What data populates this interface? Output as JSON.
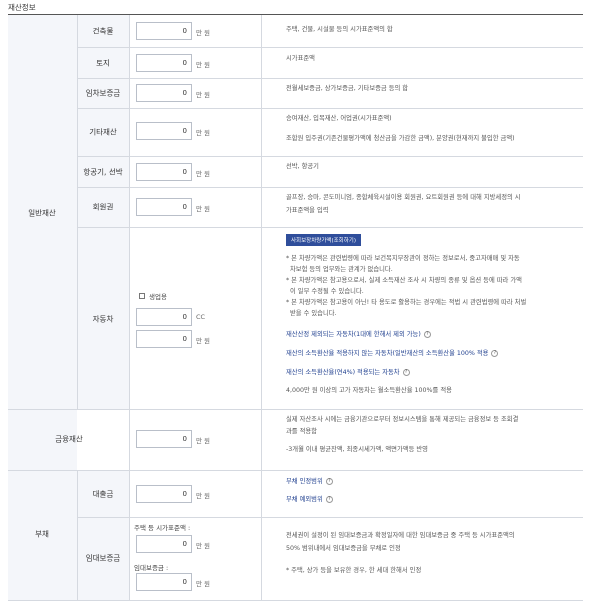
{
  "section_title": "재산정보",
  "categories": {
    "general": "일반재산",
    "financial": "금융재산",
    "debt": "부채"
  },
  "unit_won": "만 원",
  "unit_cc": "CC",
  "rows": {
    "building": {
      "label": "건축물",
      "value": "0",
      "desc": "주택, 건물, 시설물 등의 시가표준액의 합"
    },
    "land": {
      "label": "토지",
      "value": "0",
      "desc": "시가표준액"
    },
    "lease": {
      "label": "임차보증금",
      "value": "0",
      "desc": "전월세보증금, 상가보증금, 기타보증금 등의 합"
    },
    "other": {
      "label": "기타재산",
      "value": "0",
      "desc1": "승여재산, 입목재산, 어업권(시가표준액)",
      "desc2": "조합원 입주권(기존건물평가액에 청산금을 가감한 금액), 분양권(현재까지 불입한 금액)"
    },
    "aircraft": {
      "label": "항공기, 선박",
      "value": "0",
      "desc": "선박, 항공기"
    },
    "membership": {
      "label": "회원권",
      "value": "0",
      "desc1": "골프장, 승마, 콘도미니엄, 종합체육시설이용 회원권, 요트회원권 등에 대해 지방세정의 시",
      "desc2": "가표준액을 입력"
    },
    "car": {
      "label": "자동차",
      "business_use": "생업용",
      "cc_value": "0",
      "value": "0",
      "button": "사회보장차량가액(조회하기)",
      "notes": [
        "* 본 차량가액은 관련법령에 따라 보건복지부장관이 정하는 정보로서, 중고자매매 및 자동",
        "차보험 등의 업무와는 관계가 없습니다.",
        "* 본 차량가액은 참고용으로서, 실제 소득재산 조사 시 차량의 종류 및 옵션 등에 따라 가액",
        "이 일부 수정될 수 있습니다.",
        "* 본 차량가액은 참고용이 아닌! 타 용도로 활용하는 경우에는 적법 시 관련법령에 따라 처벌",
        "받을 수 있습니다."
      ],
      "links": [
        "재산산정 제외되는 자동차(1대에 한해서 제외 가능)",
        "재산의 소득환산율 적용하지 않는 자동차(일반재산의 소득환산율 100% 적용",
        "재산의 소득환산율(연4%) 적용되는 자동차",
        "4,000만 원 이상의 고가 자동차는 월소득환산율 100%를 적용"
      ]
    },
    "financial": {
      "value": "0",
      "desc1": "실제 자산조사 시에는 금융기관으로부터 정보시스템을 통해 제공되는 금융정보 등 조회결",
      "desc2": "과를 적용함",
      "desc3": "-3개월 이내 평균잔액, 최종시세가액, 액면가액등 반영"
    },
    "loan": {
      "label": "대출금",
      "value": "0",
      "link1": "부채 인정범위",
      "link2": "부채 예외범위"
    },
    "lease_deposit": {
      "label": "임대보증금",
      "sub_label1": "주택 등 시가표준액 :",
      "value1": "0",
      "sub_label2": "임대보증금 :",
      "value2": "0",
      "desc1": "전세권이 설정이 된 임대보증금과 확정일자에 대한 임대보증금 중 주택 등 시가표준액의",
      "desc2": "50% 범위내에서 임대보증금을 부채로 인정",
      "desc3": "* 주택, 상가 등을 보유한 경우, 한 세대 한해서 인정"
    }
  }
}
